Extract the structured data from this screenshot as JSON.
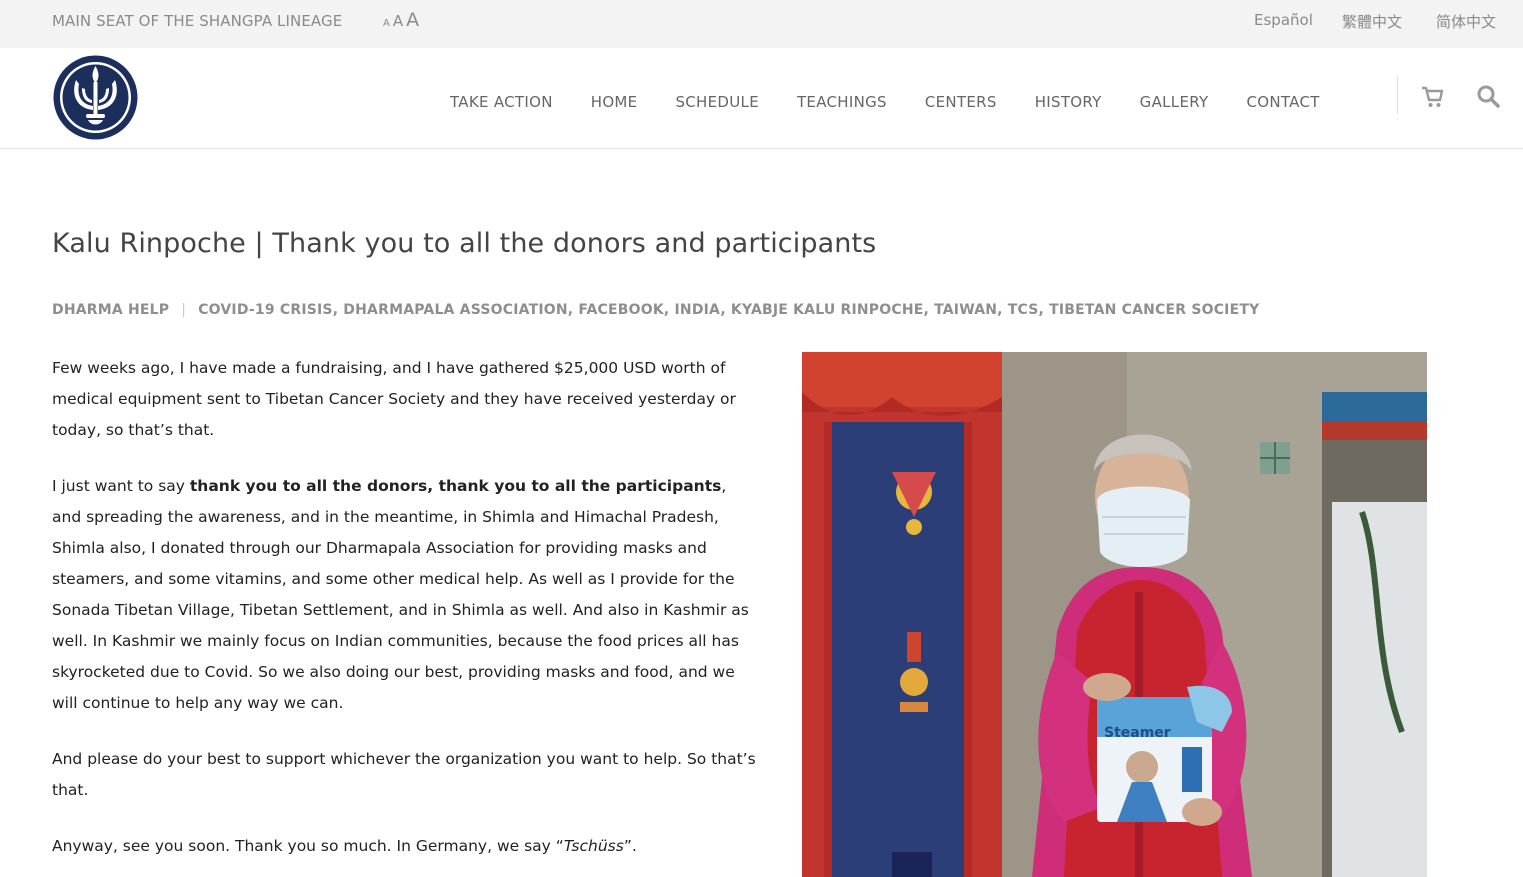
{
  "topbar": {
    "lineage": "MAIN SEAT OF THE SHANGPA LINEAGE",
    "font_small": "A",
    "font_medium": "A",
    "font_large": "A",
    "languages": [
      "Español",
      "繁體中文",
      "简体中文"
    ]
  },
  "nav": {
    "items": [
      "TAKE ACTION",
      "HOME",
      "SCHEDULE",
      "TEACHINGS",
      "CENTERS",
      "HISTORY",
      "GALLERY",
      "CONTACT"
    ],
    "icons": [
      "cart-icon",
      "search-icon"
    ]
  },
  "post": {
    "title": "Kalu Rinpoche | Thank you to all the donors and participants",
    "category": "DHARMA HELP",
    "tags": "COVID-19 CRISIS, DHARMAPALA ASSOCIATION, FACEBOOK, INDIA, KYABJE KALU RINPOCHE, TAIWAN, TCS, TIBETAN CANCER SOCIETY",
    "p1": "Few weeks ago, I have made a fundraising, and I have gathered $25,000 USD worth of medical equipment sent to Tibetan Cancer Society and they have received yesterday or today, so that’s that.",
    "p2_start": "I just want to say ",
    "p2_bold": "thank you to all the donors, thank you to all the participants",
    "p2_rest": ", and spreading the awareness, and in the meantime, in Shimla and Himachal Pradesh, Shimla also, I donated through our Dharmapala Association for providing masks and steamers, and some vitamins, and some other medical help. As well as I provide for the Sonada Tibetan Village, Tibetan Settlement, and in Shimla as well. And also in Kashmir as well. In Kashmir we mainly focus on Indian communities, because the food prices all has skyrocketed due to Covid. So we also doing our best, providing masks and food, and we will continue to help any way we can.",
    "p3": "And please do your best to support whichever the organization you want to help. So that’s that.",
    "p4_start": "Anyway, see you soon. Thank you so much. In Germany, we say “",
    "p4_italic": "Tschüss",
    "p4_end": "”.",
    "photo_box_text": "Steamer"
  },
  "colors": {
    "topbar_bg": "#f3f3f3",
    "logo_navy": "#1c2f5c",
    "muted_text": "#8a8a8a"
  }
}
